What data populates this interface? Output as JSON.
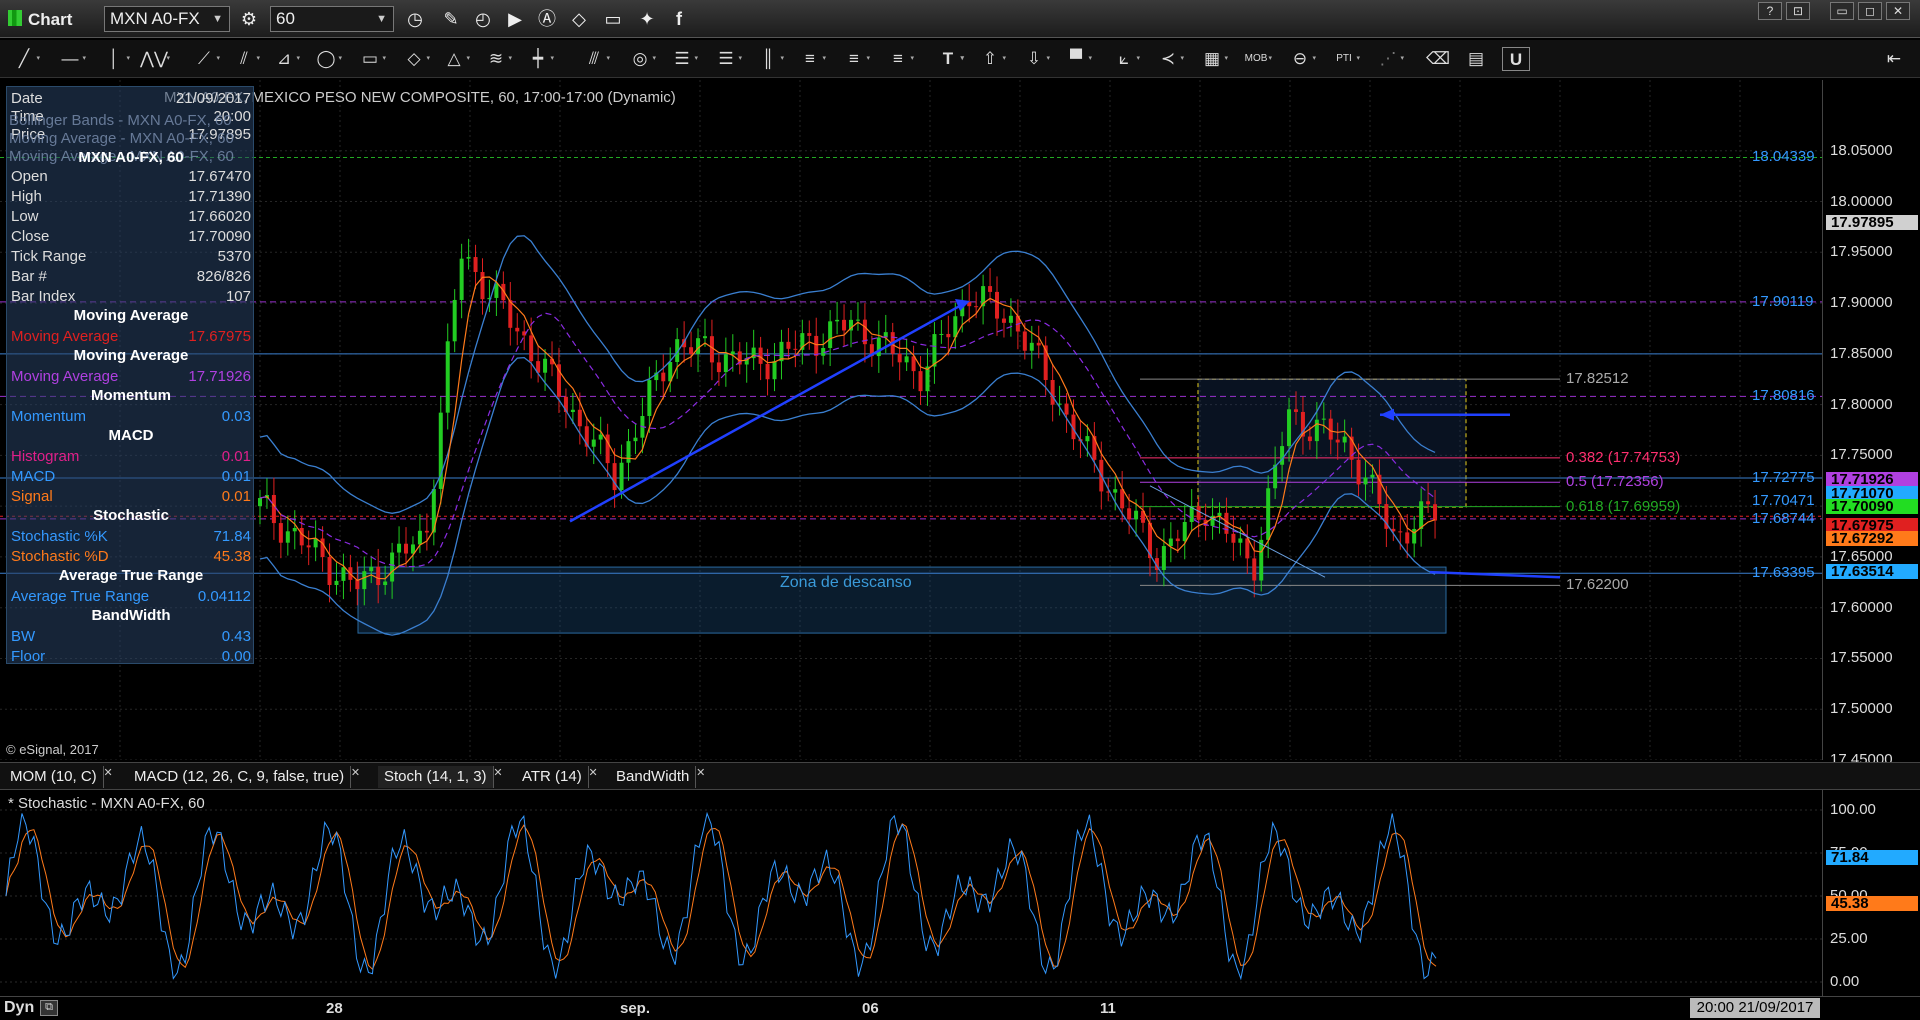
{
  "app": {
    "title": "Chart",
    "symbol": "MXN A0-FX",
    "interval": "60"
  },
  "window_buttons": [
    "?",
    "⊡",
    "▭",
    "◻",
    "✕"
  ],
  "chart_title": "MXN A0-FX, MEXICO PESO NEW COMPOSITE, 60, 17:00-17:00 (Dynamic)",
  "data_window": {
    "header": [
      {
        "k": "Date",
        "v": "21/09/2017"
      },
      {
        "k": "Time",
        "v": "20:00"
      },
      {
        "k": "Price",
        "v": "17.97895"
      }
    ],
    "overlay_labels": [
      "Bollinger Bands - MXN A0-FX, 60",
      "Moving Average - MXN A0-FX, 60",
      "Moving Average - MXN A0-FX, 60"
    ],
    "section_title": "MXN A0-FX, 60",
    "rows": [
      {
        "k": "Open",
        "v": "17.67470"
      },
      {
        "k": "High",
        "v": "17.71390"
      },
      {
        "k": "Low",
        "v": "17.66020"
      },
      {
        "k": "Close",
        "v": "17.70090"
      },
      {
        "k": "Tick Range",
        "v": "5370"
      },
      {
        "k": "Bar #",
        "v": "826/826"
      },
      {
        "k": "Bar Index",
        "v": "107"
      }
    ],
    "studies": [
      {
        "title": "Moving Average",
        "k": "Moving Average",
        "v": "17.67975",
        "color": "#e02020"
      },
      {
        "title": "Moving Average",
        "k": "Moving Average",
        "v": "17.71926",
        "color": "#b040e0"
      },
      {
        "title": "Momentum",
        "k": "Momentum",
        "v": "0.03",
        "color": "#3399ff"
      },
      {
        "title": "MACD",
        "k": "Histogram",
        "v": "0.01",
        "color": "#e0208a"
      },
      {
        "title": "",
        "k": "MACD",
        "v": "0.01",
        "color": "#3399ff"
      },
      {
        "title": "",
        "k": "Signal",
        "v": "0.01",
        "color": "#ff7a1a"
      },
      {
        "title": "Stochastic",
        "k": "Stochastic %K",
        "v": "71.84",
        "color": "#3399ff"
      },
      {
        "title": "",
        "k": "Stochastic %D",
        "v": "45.38",
        "color": "#ff7a1a"
      },
      {
        "title": "Average True Range",
        "k": "Average True Range",
        "v": "0.04112",
        "color": "#3399ff"
      },
      {
        "title": "BandWidth",
        "k": "BW",
        "v": "0.43",
        "color": "#3399ff"
      },
      {
        "title": "",
        "k": "Floor",
        "v": "0.00",
        "color": "#3399ff"
      }
    ]
  },
  "price_axis": [
    "18.05000",
    "18.00000",
    "17.95000",
    "17.90000",
    "17.85000",
    "17.80000",
    "17.75000",
    "17.70000",
    "17.65000",
    "17.60000",
    "17.55000",
    "17.50000",
    "17.45000"
  ],
  "price_tags": [
    {
      "label": "17.97895",
      "color": "#d0d0d0"
    },
    {
      "label": "17.71926",
      "color": "#b040e0"
    },
    {
      "label": "17.71070",
      "color": "#22aaff"
    },
    {
      "label": "17.70090",
      "color": "#22dd22"
    },
    {
      "label": "17.67975",
      "color": "#e02020"
    },
    {
      "label": "17.67292",
      "color": "#ff7a1a"
    },
    {
      "label": "17.63514",
      "color": "#22aaff"
    }
  ],
  "level_labels": [
    {
      "label": "18.04339",
      "color": "#3399ff"
    },
    {
      "label": "17.90119",
      "color": "#3399ff"
    },
    {
      "label": "17.80816",
      "color": "#3399ff"
    },
    {
      "label": "17.72775",
      "color": "#3399ff"
    },
    {
      "label": "17.70471",
      "color": "#3399ff"
    },
    {
      "label": "17.68744",
      "color": "#3399ff"
    },
    {
      "label": "17.63395",
      "color": "#3399ff"
    }
  ],
  "fib": {
    "high": "17.82512",
    "low": "17.62200",
    "levels": [
      {
        "label": "0.382 (17.74753)",
        "color": "#ff3070"
      },
      {
        "label": "0.5 (17.72356)",
        "color": "#b040e0"
      },
      {
        "label": "0.618 (17.69959)",
        "color": "#22aa22"
      }
    ]
  },
  "annotation": "Zona de descanso",
  "copyright": "© eSignal, 2017",
  "tabs": [
    "MOM (10, C)",
    "MACD (12, 26, C, 9, false, true)",
    "Stoch (14, 1, 3)",
    "ATR (14)",
    "BandWidth"
  ],
  "active_tab": "Stoch (14, 1, 3)",
  "stoch_title": "* Stochastic - MXN A0-FX, 60",
  "stoch_axis": [
    "100.00",
    "75.00",
    "50.00",
    "25.00",
    "0.00"
  ],
  "stoch_tags": [
    {
      "label": "71.84",
      "color": "#22aaff"
    },
    {
      "label": "45.38",
      "color": "#ff7a1a"
    }
  ],
  "time_axis": [
    "28",
    "sep.",
    "06",
    "11"
  ],
  "time_mode": "Dyn",
  "cursor_time": "20:00 21/09/2017",
  "colors": {
    "bull": "#22cc22",
    "bear": "#e02020",
    "bands": "#3a7fd0",
    "ma_fast": "#ff7a1a",
    "ma_slow": "#8a2be2"
  }
}
